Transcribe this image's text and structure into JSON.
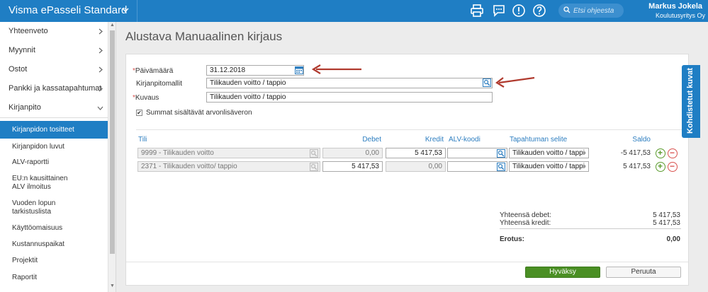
{
  "app": {
    "title": "Visma ePasseli Standard"
  },
  "topbar": {
    "icons": [
      "print-icon",
      "chat-icon",
      "alert-icon",
      "help-icon"
    ],
    "search_placeholder": "Etsi ohjeesta",
    "user_name": "Markus Jokela",
    "user_company": "Koulutusyritys Oy"
  },
  "sidebar": {
    "main_items": [
      {
        "label": "Yhteenveto"
      },
      {
        "label": "Myynnit"
      },
      {
        "label": "Ostot"
      },
      {
        "label": "Pankki ja kassatapahtumat"
      },
      {
        "label": "Kirjanpito"
      }
    ],
    "sub_items": [
      {
        "label": "Kirjanpidon tositteet",
        "active": true
      },
      {
        "label": "Kirjanpidon luvut"
      },
      {
        "label": "ALV-raportti"
      },
      {
        "label": "EU:n kausittainen ALV ilmoitus"
      },
      {
        "label": "Vuoden lopun tarkistuslista"
      },
      {
        "label": "Käyttöomaisuus"
      },
      {
        "label": "Kustannuspaikat"
      },
      {
        "label": "Projektit"
      },
      {
        "label": "Raportit"
      }
    ]
  },
  "page": {
    "title": "Alustava Manuaalinen kirjaus"
  },
  "form": {
    "required_mark": "*",
    "date_label": "Päivämäärä",
    "date_value": "31.12.2018",
    "template_label": "Kirjanpitomallit",
    "template_value": "Tilikauden voitto / tappio",
    "description_label": "Kuvaus",
    "description_value": "Tilikauden voitto / tappio",
    "vat_checkbox_label": "Summat sisältävät arvonlisäveron",
    "vat_checked": true,
    "check_mark": "✔"
  },
  "table": {
    "headers": {
      "account": "Tili",
      "debit": "Debet",
      "credit": "Kredit",
      "vat_code": "ALV-koodi",
      "event_desc": "Tapahtuman selite",
      "balance": "Saldo"
    },
    "rows": [
      {
        "account": "9999 - Tilikauden voitto",
        "debit": "0,00",
        "credit": "5 417,53",
        "vat": "",
        "desc": "Tilikauden voitto / tappio",
        "balance": "-5 417,53"
      },
      {
        "account": "2371 - Tilikauden voitto/ tappio",
        "debit": "5 417,53",
        "credit": "0,00",
        "vat": "",
        "desc": "Tilikauden voitto / tappio",
        "balance": "5 417,53"
      }
    ],
    "add_symbol": "+",
    "remove_symbol": "−"
  },
  "totals": {
    "debit_label": "Yhteensä debet:",
    "debit_value": "5 417,53",
    "credit_label": "Yhteensä kredit:",
    "credit_value": "5 417,53",
    "difference_label": "Erotus:",
    "difference_value": "0,00"
  },
  "actions": {
    "accept": "Hyväksy",
    "cancel": "Peruuta"
  },
  "side_tab": {
    "label": "Kohdistetut kuvat"
  },
  "colors": {
    "brand": "#1f7ec4",
    "accept": "#4a8f24",
    "annotation_arrow": "#b03a2e"
  }
}
